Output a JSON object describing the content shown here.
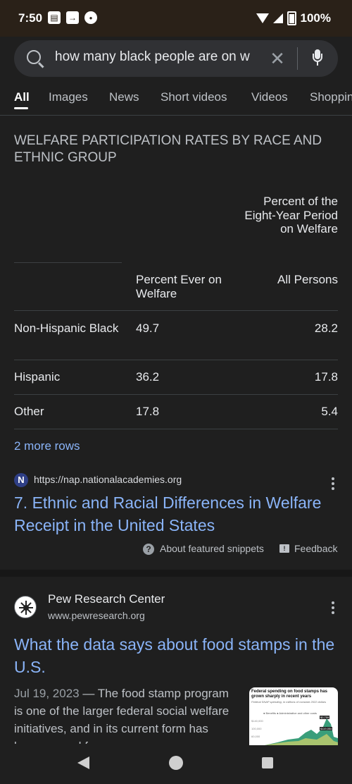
{
  "status_bar": {
    "time": "7:50",
    "battery": "100%",
    "left_icons": [
      "clipboard-icon",
      "forward-icon",
      "sports-ball-icon"
    ]
  },
  "search": {
    "query": "how many black people are on w",
    "search_icon": "search-icon",
    "clear_icon": "close-icon",
    "mic_icon": "mic-icon"
  },
  "tabs": [
    "All",
    "Images",
    "News",
    "Short videos",
    "Videos",
    "Shoppin"
  ],
  "snippet": {
    "title": "WELFARE PARTICIPATION RATES BY RACE AND ETHNIC GROUP",
    "group_header": "Percent of the Eight-Year Period on Welfare",
    "columns": [
      "",
      "Percent Ever on Welfare",
      "All Persons"
    ],
    "rows": [
      [
        "Non-Hispanic Black",
        "49.7",
        "28.2"
      ],
      [
        "Hispanic",
        "36.2",
        "17.8"
      ],
      [
        "Other",
        "17.8",
        "5.4"
      ]
    ],
    "more_rows": "2 more rows",
    "source_url": "https://nap.nationalacademies.org",
    "source_title": "7. Ethnic and Racial Differences in Welfare Receipt in the United States",
    "about_label": "About featured snippets",
    "feedback_label": "Feedback"
  },
  "result2": {
    "site_name": "Pew Research Center",
    "site_url": "www.pewresearch.org",
    "title": "What the data says about food stamps in the U.S.",
    "date": "Jul 19, 2023",
    "snippet": " — The food stamp program is one of the larger federal social welfare initiatives, and in its current form has been around for ...",
    "thumbnail": {
      "title": "Federal spending on food stamps has grown sharply in recent years",
      "subtitle": "Federal SNAP spending, in millions of constant 2022 dollars",
      "legend": "● Benefits  ● Administrative and other costs",
      "tag_1": "$0,759",
      "tag_2": "$119,054",
      "axis_1": "$140,000",
      "axis_2": "100,000",
      "axis_3": "60,000"
    }
  },
  "colors": {
    "background": "#1f1f1f",
    "link": "#8ab4f8",
    "search_bar": "#303134"
  }
}
